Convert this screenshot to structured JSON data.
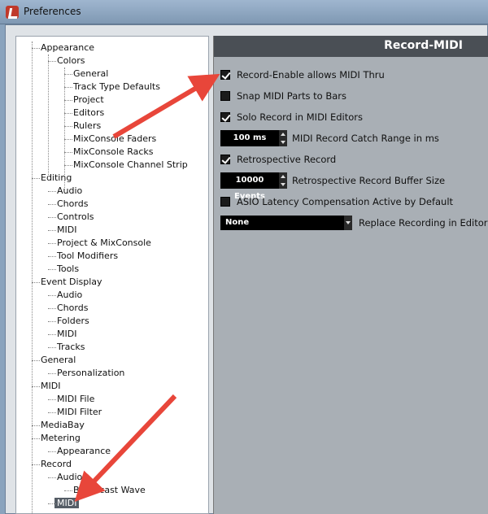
{
  "window": {
    "title": "Preferences"
  },
  "tree": {
    "items": [
      {
        "label": "Appearance",
        "level": 0
      },
      {
        "label": "Colors",
        "level": 1
      },
      {
        "label": "General",
        "level": 2
      },
      {
        "label": "Track Type Defaults",
        "level": 2
      },
      {
        "label": "Project",
        "level": 2
      },
      {
        "label": "Editors",
        "level": 2
      },
      {
        "label": "Rulers",
        "level": 2
      },
      {
        "label": "MixConsole Faders",
        "level": 2
      },
      {
        "label": "MixConsole Racks",
        "level": 2
      },
      {
        "label": "MixConsole Channel Strip",
        "level": 2
      },
      {
        "label": "Editing",
        "level": 0
      },
      {
        "label": "Audio",
        "level": 1
      },
      {
        "label": "Chords",
        "level": 1
      },
      {
        "label": "Controls",
        "level": 1
      },
      {
        "label": "MIDI",
        "level": 1
      },
      {
        "label": "Project & MixConsole",
        "level": 1
      },
      {
        "label": "Tool Modifiers",
        "level": 1
      },
      {
        "label": "Tools",
        "level": 1
      },
      {
        "label": "Event Display",
        "level": 0
      },
      {
        "label": "Audio",
        "level": 1
      },
      {
        "label": "Chords",
        "level": 1
      },
      {
        "label": "Folders",
        "level": 1
      },
      {
        "label": "MIDI",
        "level": 1
      },
      {
        "label": "Tracks",
        "level": 1
      },
      {
        "label": "General",
        "level": 0
      },
      {
        "label": "Personalization",
        "level": 1
      },
      {
        "label": "MIDI",
        "level": 0
      },
      {
        "label": "MIDI File",
        "level": 1
      },
      {
        "label": "MIDI Filter",
        "level": 1
      },
      {
        "label": "MediaBay",
        "level": 0
      },
      {
        "label": "Metering",
        "level": 0
      },
      {
        "label": "Appearance",
        "level": 1
      },
      {
        "label": "Record",
        "level": 0
      },
      {
        "label": "Audio",
        "level": 1
      },
      {
        "label": "Broadcast Wave",
        "level": 2
      },
      {
        "label": "MIDI",
        "level": 1,
        "selected": true
      }
    ]
  },
  "panel": {
    "title": "Record-MIDI",
    "record_enable_thru": {
      "label": "Record-Enable allows MIDI Thru",
      "checked": true
    },
    "snap_midi_parts": {
      "label": "Snap MIDI Parts to Bars",
      "checked": false
    },
    "solo_record": {
      "label": "Solo Record in MIDI Editors",
      "checked": true
    },
    "catch_range": {
      "value": "100 ms",
      "label": "MIDI Record Catch Range in ms"
    },
    "retrospective": {
      "label": "Retrospective Record",
      "checked": true
    },
    "retro_buffer": {
      "value": "10000 Events",
      "label": "Retrospective Record Buffer Size"
    },
    "asio_latency": {
      "label": "ASIO Latency Compensation Active by Default",
      "checked": false
    },
    "replace_recording": {
      "value": "None",
      "label": "Replace Recording in Editors"
    }
  },
  "annotation": {
    "arrow_color": "#e8463a"
  }
}
